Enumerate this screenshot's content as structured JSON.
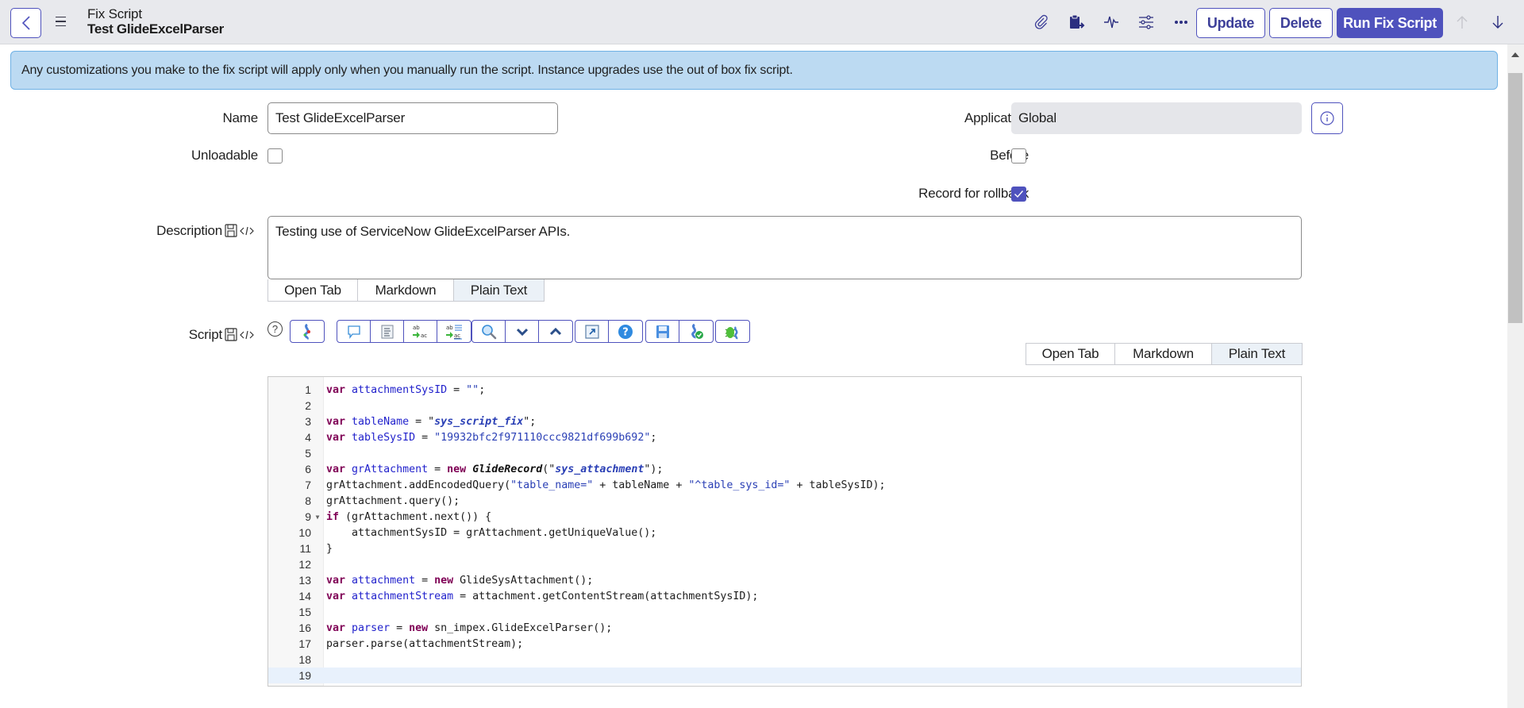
{
  "header": {
    "record_type": "Fix Script",
    "record_name": "Test GlideExcelParser",
    "back_icon": "chevron-left-icon",
    "menu_icon": "hamburger-menu-icon",
    "icons": [
      "paperclip-icon",
      "clipboard-export-icon",
      "activity-pulse-icon",
      "sliders-icon",
      "more-ellipsis-icon"
    ],
    "buttons": {
      "update": "Update",
      "delete": "Delete",
      "run": "Run Fix Script"
    },
    "nav": {
      "prev_icon": "arrow-up-icon",
      "next_icon": "arrow-down-icon"
    }
  },
  "banner": {
    "message": "Any customizations you make to the fix script will apply only when you manually run the script. Instance upgrades use the out of box fix script."
  },
  "form": {
    "name": {
      "label": "Name",
      "value": "Test GlideExcelParser"
    },
    "unloadable": {
      "label": "Unloadable",
      "checked": false
    },
    "application": {
      "label": "Application",
      "value": "Global"
    },
    "before": {
      "label": "Before",
      "checked": false
    },
    "record_for_rollback": {
      "label": "Record for rollback",
      "checked": true
    },
    "description": {
      "label": "Description",
      "value": "Testing use of ServiceNow GlideExcelParser APIs.",
      "tabs": [
        "Open Tab",
        "Markdown",
        "Plain Text"
      ],
      "active_tab": "Plain Text"
    },
    "script": {
      "label": "Script",
      "tabs": [
        "Open Tab",
        "Markdown",
        "Plain Text"
      ],
      "active_tab": "Plain Text",
      "toolbar": [
        [
          "syntax-check-icon"
        ],
        [
          "comment-icon",
          "format-code-icon",
          "replace-icon",
          "replace-all-icon"
        ],
        [
          "search-icon",
          "next-match-icon",
          "previous-match-icon"
        ],
        [
          "fullscreen-icon",
          "help-icon"
        ],
        [
          "save-icon",
          "script-validate-icon"
        ],
        [
          "script-debugger-icon"
        ]
      ],
      "lines": [
        "var attachmentSysID = \"\";",
        "",
        "var tableName = \"sys_script_fix\";",
        "var tableSysID = \"19932bfc2f971110ccc9821df699b692\";",
        "",
        "var grAttachment = new GlideRecord(\"sys_attachment\");",
        "grAttachment.addEncodedQuery(\"table_name=\" + tableName + \"^table_sys_id=\" + tableSysID);",
        "grAttachment.query();",
        "if (grAttachment.next()) {",
        "    attachmentSysID = grAttachment.getUniqueValue();",
        "}",
        "",
        "var attachment = new GlideSysAttachment();",
        "var attachmentStream = attachment.getContentStream(attachmentSysID);",
        "",
        "var parser = new sn_impex.GlideExcelParser();",
        "parser.parse(attachmentStream);",
        "",
        ""
      ],
      "active_line": 19
    }
  },
  "colors": {
    "brand": "#4f52bd",
    "banner_bg": "#bcdaf2",
    "banner_border": "#6fb1e5",
    "header_bg": "#e8e9ed"
  }
}
